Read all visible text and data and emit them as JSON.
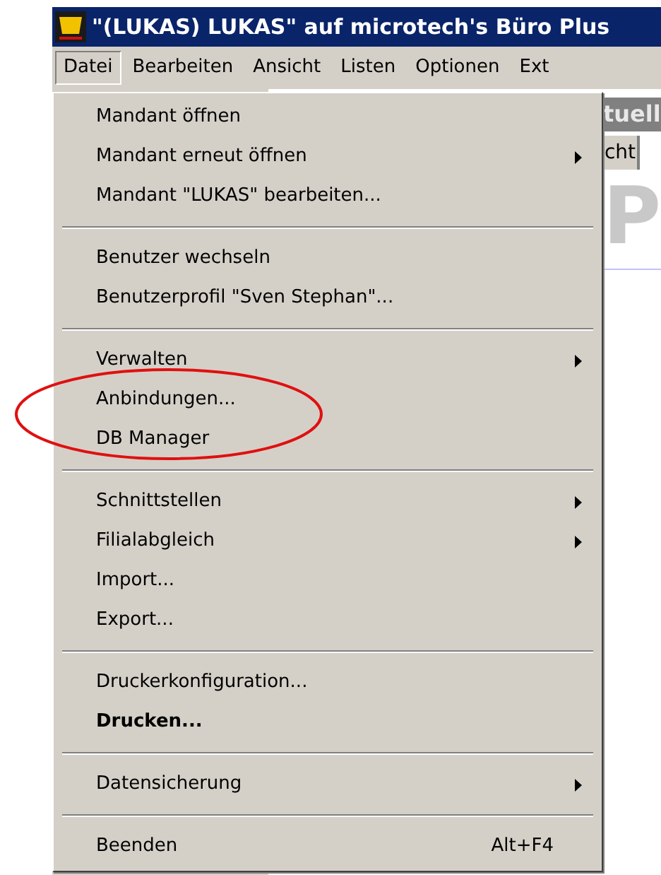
{
  "window": {
    "title": "\"(LUKAS) LUKAS\" auf microtech's Büro Plus"
  },
  "menu_bar": [
    {
      "label": "Datei",
      "selected": true
    },
    {
      "label": "Bearbeiten",
      "selected": false
    },
    {
      "label": "Ansicht",
      "selected": false
    },
    {
      "label": "Listen",
      "selected": false
    },
    {
      "label": "Optionen",
      "selected": false
    },
    {
      "label": "Ext",
      "selected": false
    }
  ],
  "background": {
    "header": "tuell",
    "tabs": [
      "cht"
    ],
    "logo_letter": "P"
  },
  "menu": [
    [
      {
        "label": "Mandant öffnen",
        "submenu": false,
        "bold": false
      },
      {
        "label": "Mandant erneut öffnen",
        "submenu": true,
        "bold": false
      },
      {
        "label": "Mandant \"LUKAS\" bearbeiten...",
        "submenu": false,
        "bold": false
      }
    ],
    [
      {
        "label": "Benutzer wechseln",
        "submenu": false,
        "bold": false
      },
      {
        "label": "Benutzerprofil \"Sven Stephan\"...",
        "submenu": false,
        "bold": false
      }
    ],
    [
      {
        "label": "Verwalten",
        "submenu": true,
        "bold": false
      },
      {
        "label": "Anbindungen...",
        "submenu": false,
        "bold": false
      },
      {
        "label": "DB Manager",
        "submenu": false,
        "bold": false
      }
    ],
    [
      {
        "label": "Schnittstellen",
        "submenu": true,
        "bold": false
      },
      {
        "label": "Filialabgleich",
        "submenu": true,
        "bold": false
      },
      {
        "label": "Import...",
        "submenu": false,
        "bold": false
      },
      {
        "label": "Export...",
        "submenu": false,
        "bold": false
      }
    ],
    [
      {
        "label": "Druckerkonfiguration...",
        "submenu": false,
        "bold": false
      },
      {
        "label": "Drucken...",
        "submenu": false,
        "bold": true
      }
    ],
    [
      {
        "label": "Datensicherung",
        "submenu": true,
        "bold": false
      }
    ],
    [
      {
        "label": "Beenden",
        "submenu": false,
        "bold": false,
        "shortcut": "Alt+F4"
      }
    ]
  ]
}
